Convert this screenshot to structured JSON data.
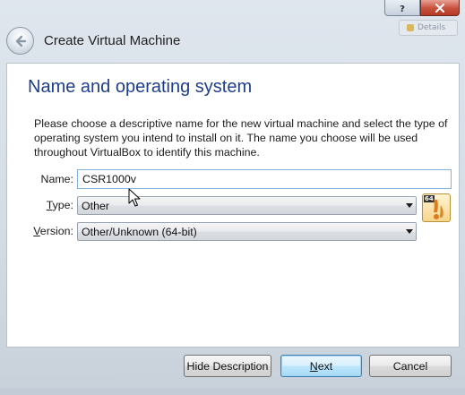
{
  "window": {
    "title": "Create Virtual Machine",
    "background_tab_label": "Details"
  },
  "page": {
    "heading": "Name and operating system",
    "description": "Please choose a descriptive name for the new virtual machine and select the type of operating system you intend to install on it. The name you choose will be used throughout VirtualBox to identify this machine."
  },
  "form": {
    "name_label": "Name:",
    "name_value": "CSR1000v",
    "type_label_pre": "",
    "type_label_mn": "T",
    "type_label_post": "ype:",
    "type_value": "Other",
    "version_label_pre": "",
    "version_label_mn": "V",
    "version_label_post": "ersion:",
    "version_value": "Other/Unknown (64-bit)",
    "os_icon": "other-64-os-icon",
    "os_badge": "64"
  },
  "buttons": {
    "hide_description": "Hide Description",
    "next_mn": "N",
    "next_rest": "ext",
    "cancel": "Cancel"
  },
  "colors": {
    "heading": "#1f3d8f",
    "default_button_border": "#3c7fb1",
    "close_button": "#c7503c"
  }
}
